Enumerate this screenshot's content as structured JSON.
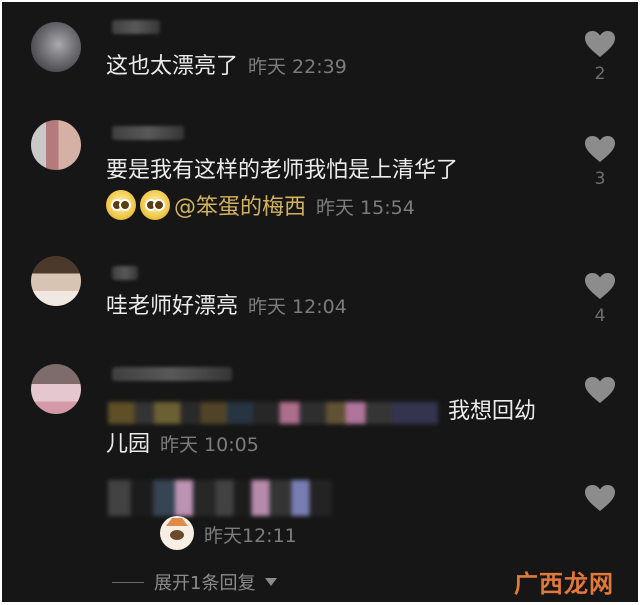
{
  "comments": [
    {
      "text": "这也太漂亮了",
      "time": "昨天 22:39",
      "likes": "2"
    },
    {
      "text": "要是我有这样的老师我怕是上清华了",
      "mention": "@笨蛋的梅西",
      "time": "昨天 15:54",
      "likes": "3"
    },
    {
      "text": "哇老师好漂亮",
      "time": "昨天 12:04",
      "likes": "4"
    },
    {
      "text_tail": "我想回幼",
      "text_line2": "儿园",
      "time": "昨天 10:05"
    }
  ],
  "reply": {
    "time": "昨天12:11"
  },
  "expand_replies": "展开1条回复",
  "watermark": "广西龙网",
  "icons": {
    "like": "heart-icon",
    "reply_sticker": "cat-face-icon",
    "emoji": "pleading-face-emoji",
    "expand": "caret-down-icon"
  },
  "colors": {
    "background": "#161616",
    "text": "#ececec",
    "time": "#7c7c7c",
    "mention": "#d3b35c",
    "watermark": "#e2783a"
  }
}
